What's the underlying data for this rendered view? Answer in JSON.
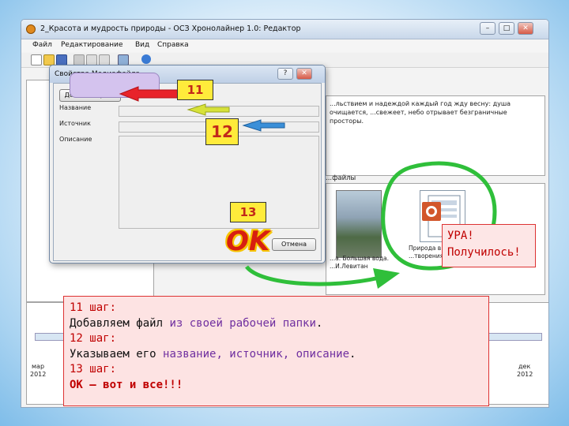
{
  "window": {
    "title": "2_Красота и мудрость природы - ОСЗ Хронолайнер 1.0: Редактор",
    "minimize": "–",
    "maximize": "□",
    "close": "✕"
  },
  "menu": [
    "Файл",
    "Редактирование",
    "Вид",
    "Справка"
  ],
  "description_text": "...льствием и надеждой каждый год жду весну: душа очищается, ...свежеет, небо отрывает безграничные просторы.",
  "files_label": "...файлы",
  "files": [
    {
      "caption": "...а. Большая вода. ...И.Левитан"
    },
    {
      "caption": "Природа в... ...творениях..."
    }
  ],
  "timeline": {
    "start_month": "мар",
    "start_year": "2012",
    "end_month": "дек",
    "end_year": "2012"
  },
  "dialog": {
    "title": "Свойства Медиафайла",
    "help": "?",
    "close": "✕",
    "add_file_button": "Добавить файл",
    "name_label": "Название",
    "source_label": "Источник",
    "description_label": "Описание",
    "cancel_button": "Отмена"
  },
  "annotations": {
    "step11_badge": "11",
    "step12_badge": "12",
    "step13_badge": "13",
    "ok_stamp": "OK",
    "success_line1": "УРА!",
    "success_line2": "Получилось!"
  },
  "instructions": {
    "step11_title": "11 шаг:",
    "step11_text_a": "Добавляем файл ",
    "step11_text_b": "из своей рабочей папки",
    "step11_text_c": ".",
    "step12_title": "12 шаг:",
    "step12_text_a": "Указываем его ",
    "step12_text_b": "название, источник, описание",
    "step12_text_c": ".",
    "step13_title": "13 шаг:",
    "step13_text": "ОК – вот и все!!!"
  },
  "colors": {
    "arrow_red": "#e8232a",
    "arrow_yellow": "#d7e23a",
    "arrow_blue": "#3a8fd8",
    "circle_green": "#2fbf3a",
    "annotation_red": "#c00000",
    "annotation_purple": "#7030a0"
  }
}
